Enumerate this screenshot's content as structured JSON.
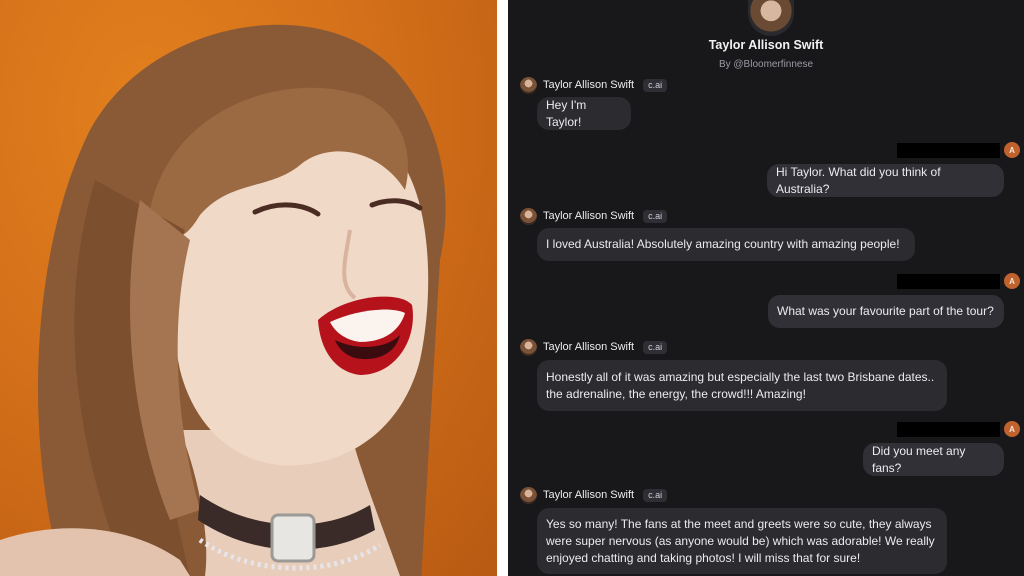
{
  "character": {
    "name": "Taylor Allison Swift",
    "byline": "By @Bloomerfinnese",
    "badge": "c.ai"
  },
  "user": {
    "avatar_letter": "A"
  },
  "messages": [
    {
      "role": "bot",
      "lines": [
        "Hey I'm Taylor!"
      ]
    },
    {
      "role": "user",
      "lines": [
        "Hi Taylor. What did you think of Australia?"
      ]
    },
    {
      "role": "bot",
      "lines": [
        "I loved Australia! Absolutely amazing country with amazing people!"
      ]
    },
    {
      "role": "user",
      "lines": [
        "What was your favourite part of the tour?"
      ]
    },
    {
      "role": "bot",
      "lines": [
        "Honestly all of it was amazing but especially the last two Brisbane dates..",
        "the adrenaline, the energy, the crowd!!! Amazing!"
      ]
    },
    {
      "role": "user",
      "lines": [
        "Did you meet any fans?"
      ]
    },
    {
      "role": "bot",
      "lines": [
        "Yes so many! The fans at the meet and greets were so cute, they always",
        "were super nervous (as anyone would be) which was adorable! We really",
        "enjoyed chatting and taking photos! I will miss that for sure!"
      ]
    }
  ],
  "colors": {
    "chat_background": "#18181b",
    "bubble": "#2b2b30",
    "photo_background": "#d4701a"
  }
}
